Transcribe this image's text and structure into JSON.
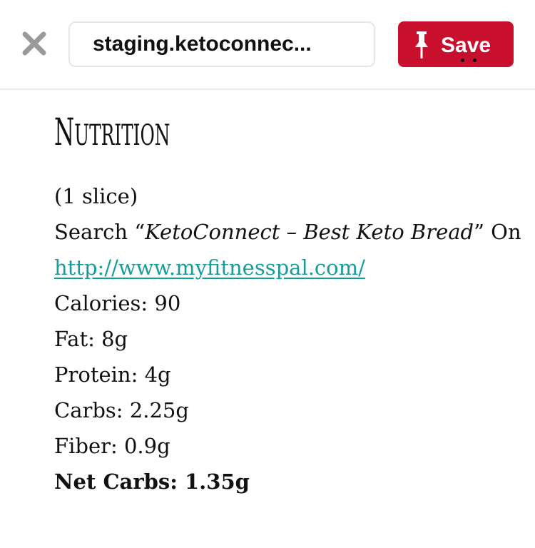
{
  "toolbar": {
    "close_icon": "close-icon",
    "url_text": "staging.ketoconnec...",
    "save_label": "Save",
    "save_icon": "pin-icon",
    "save_color": "#c8102e"
  },
  "nutrition": {
    "heading": "Nutrition",
    "serving": "(1 slice)",
    "search_prefix": "Search “",
    "search_term": "KetoConnect – Best Keto Bread",
    "search_suffix": "” On",
    "link_text": "http://www.myfitnesspal.com/",
    "link_color": "#179c9c",
    "calories": "Calories: 90",
    "fat": "Fat: 8g",
    "protein": "Protein: 4g",
    "carbs": "Carbs: 2.25g",
    "fiber": "Fiber: 0.9g",
    "net_carbs": "Net Carbs: 1.35g"
  }
}
